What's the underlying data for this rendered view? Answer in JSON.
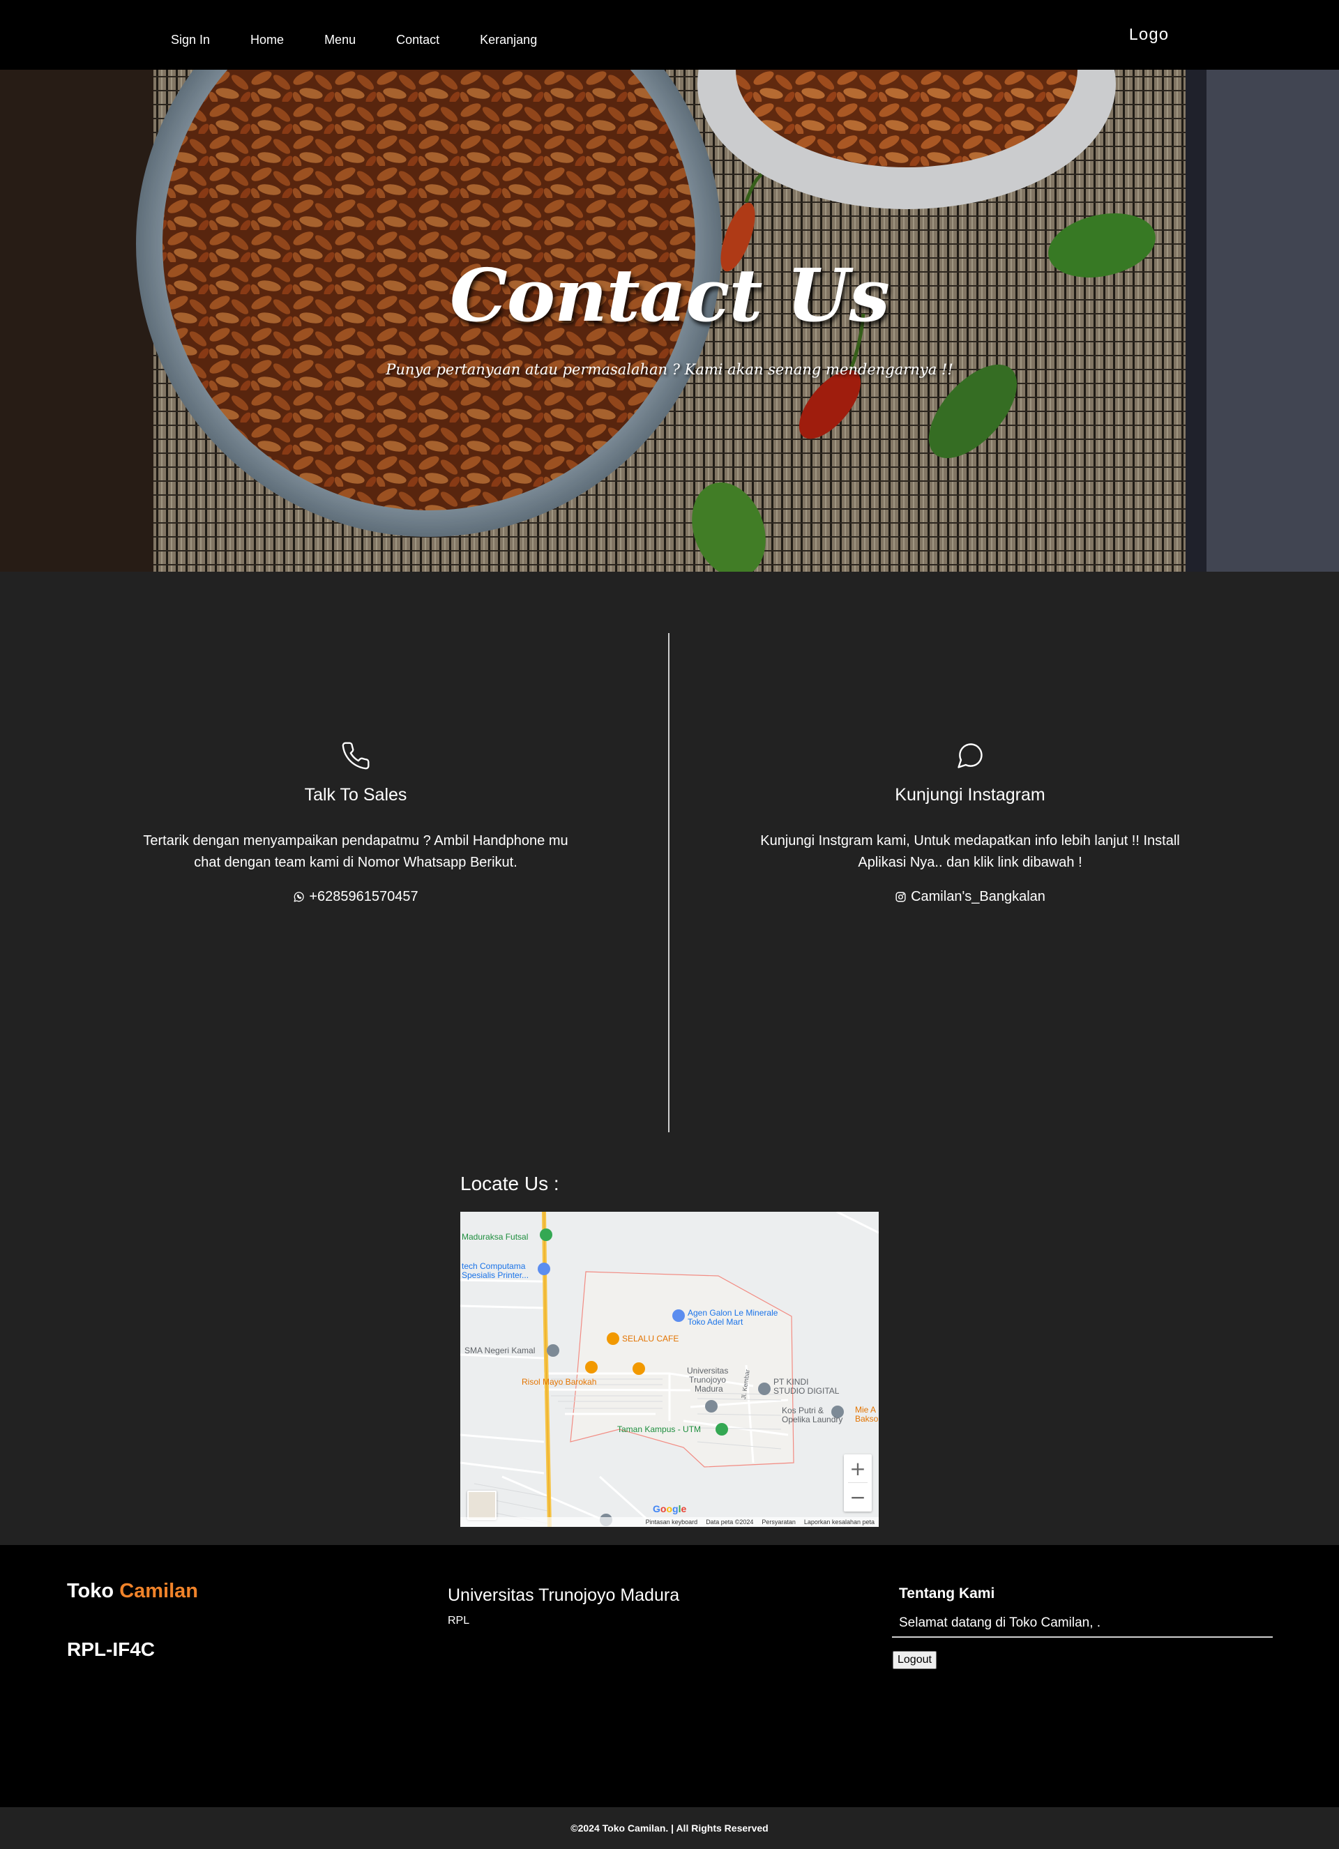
{
  "nav": {
    "items": [
      "Sign In",
      "Home",
      "Menu",
      "Contact",
      "Keranjang"
    ],
    "logo": "Logo"
  },
  "hero": {
    "title": "Contact Us",
    "subtitle": "Punya pertanyaan atau permasalahan ? Kami akan senang mendengarnya !!"
  },
  "contact": {
    "sales": {
      "icon": "phone-icon",
      "heading": "Talk To Sales",
      "text": "Tertarik dengan menyampaikan pendapatmu ? Ambil Handphone mu chat dengan team kami di Nomor Whatsapp Berikut.",
      "link_icon": "whatsapp-icon",
      "link": "+6285961570457"
    },
    "instagram": {
      "icon": "chat-bubble-icon",
      "heading": "Kunjungi Instagram",
      "text": "Kunjungi Instgram kami, Untuk medapatkan info lebih lanjut !! Install Aplikasi Nya.. dan klik link dibawah !",
      "link_icon": "instagram-icon",
      "link": "Camilan's_Bangkalan"
    }
  },
  "locate": {
    "title": "Locate Us :",
    "map": {
      "places": [
        "Maduraksa Futsal",
        "tech Computama",
        "Spesialis Printer...",
        "Agen Galon Le Minerale",
        "Toko Adel Mart",
        "SELALU CAFE",
        "SMA Negeri Kamal",
        "Risol Mayo Barokah",
        "Universitas",
        "Trunojoyo",
        "Madura",
        "PT KINDI",
        "STUDIO DIGITAL",
        "Kos Putri &",
        "Opelika Laundry",
        "Mie A",
        "Bakso",
        "Taman Kampus - UTM",
        "Jl. Kembar"
      ],
      "zoom_in": "+",
      "zoom_out": "−",
      "attribution": [
        "Pintasan keyboard",
        "Data peta ©2024",
        "Persyaratan",
        "Laporkan kesalahan peta"
      ],
      "google": [
        "G",
        "o",
        "o",
        "g",
        "l",
        "e"
      ]
    }
  },
  "footer": {
    "brand_prefix": "Toko",
    "brand_accent": "Camilan",
    "class_code": "RPL-IF4C",
    "university": "Universitas Trunojoyo Madura",
    "department": "RPL",
    "about_title": "Tentang Kami",
    "about_text": "Selamat datang di Toko Camilan, .",
    "logout": "Logout",
    "copyright": "©2024 Toko Camilan. | All Rights Reserved"
  },
  "colors": {
    "accent": "#f0832a",
    "page_bg": "#222222",
    "nav_bg": "#000000"
  }
}
